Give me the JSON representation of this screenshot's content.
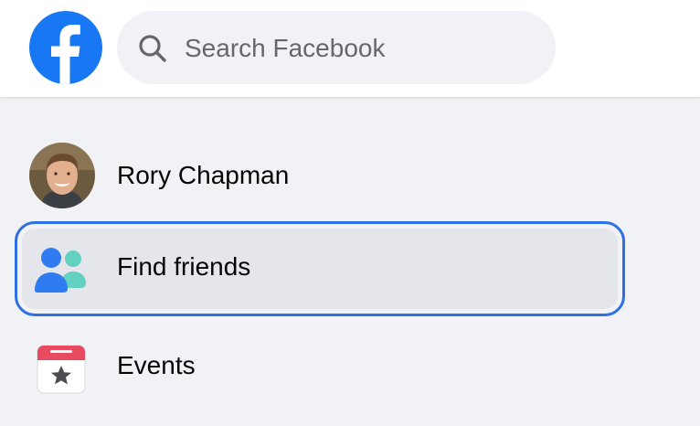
{
  "header": {
    "logo_icon": "facebook-logo",
    "brand_color": "#1877f2",
    "search": {
      "placeholder": "Search Facebook",
      "value": "",
      "icon": "search-icon"
    }
  },
  "sidebar": {
    "items": [
      {
        "label": "Rory Chapman",
        "icon": "avatar"
      },
      {
        "label": "Find friends",
        "icon": "friends-icon",
        "focused": true
      },
      {
        "label": "Events",
        "icon": "calendar-star-icon"
      }
    ],
    "focus_ring_color": "#2f6fe4"
  }
}
